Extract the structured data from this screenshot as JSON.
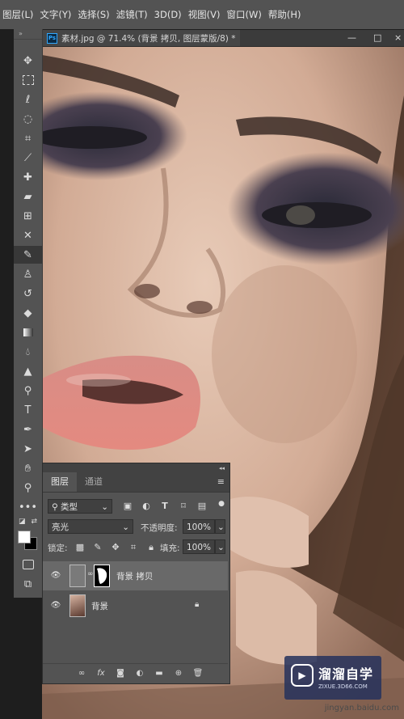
{
  "menubar": {
    "items": [
      "图层(L)",
      "文字(Y)",
      "选择(S)",
      "滤镜(T)",
      "3D(D)",
      "视图(V)",
      "窗口(W)",
      "帮助(H)"
    ]
  },
  "document": {
    "tab_title": "素材.jpg @ 71.4% (背景 拷贝, 图层蒙版/8) *",
    "close_glyph": "×"
  },
  "window": {
    "minimize": "—",
    "maximize": "□",
    "close": "×"
  },
  "toolbar": {
    "grip": "»"
  },
  "layers_panel": {
    "collapse_glyph": "◂◂",
    "tabs": [
      "图层",
      "通道"
    ],
    "filter_kind": "类型",
    "blend_mode": "亮光",
    "opacity_label": "不透明度:",
    "opacity_value": "100%",
    "lock_label": "锁定:",
    "fill_label": "填充:",
    "fill_value": "100%",
    "layers": [
      {
        "name": "背景 拷贝",
        "visible": true,
        "selected": true
      },
      {
        "name": "背景",
        "visible": true,
        "locked": true
      }
    ]
  },
  "watermark": {
    "brand": "溜溜自学",
    "url": "ZIXUE.3D66.COM"
  },
  "footer": {
    "source": "jingyan.baidu.com"
  },
  "colors": {
    "ui_gray": "#535353",
    "dark_gray": "#3b3b3b",
    "selected_layer": "#696969",
    "accent_blue": "#31a8ff"
  }
}
